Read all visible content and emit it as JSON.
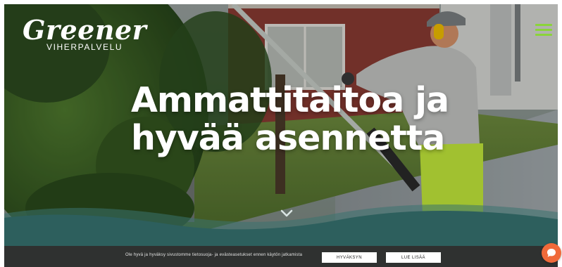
{
  "brand": {
    "name": "Greener",
    "subtitle": "VIHERPALVELU",
    "accent_color": "#8bd43a"
  },
  "header": {
    "menu_icon": "hamburger-icon"
  },
  "hero": {
    "headline_line1": "Ammattitaitoa ja",
    "headline_line2": "hyvää asennetta",
    "scroll_icon": "chevron-down-icon",
    "wave_color": "#2d5f5d"
  },
  "cookie_banner": {
    "text": "Ole hyvä ja hyväksy sivustomme tietosuoja- ja evästeasetukset ennen käytön jatkamista",
    "accept_label": "HYVÄKSYN",
    "more_label": "LUE LISÄÄ",
    "background_color": "#2f3130"
  },
  "chat_widget": {
    "icon": "chat-bubble-icon",
    "color": "#f06a3a"
  }
}
